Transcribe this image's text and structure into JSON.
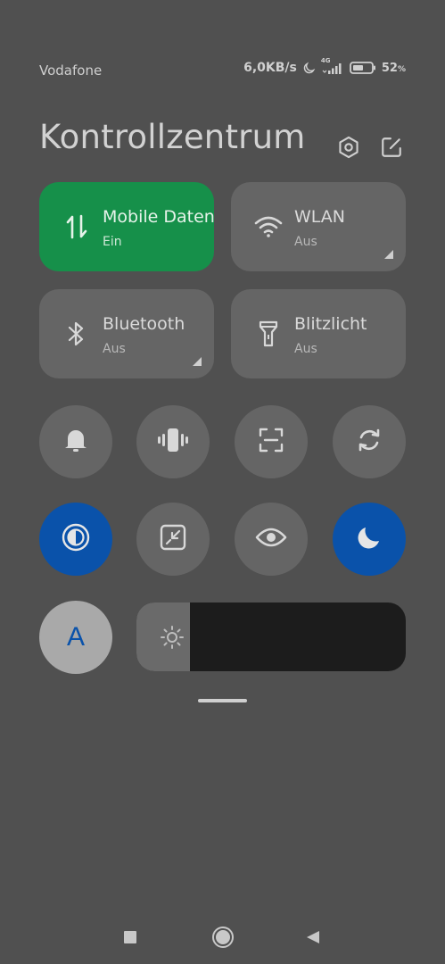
{
  "status_bar": {
    "carrier": "Vodafone",
    "net_speed": "6,0KB/s",
    "network_type": "4G",
    "battery_percent": "52",
    "battery_unit": "%",
    "icons": [
      "moon-icon",
      "signal-icon",
      "battery-icon"
    ]
  },
  "header": {
    "title": "Kontrollzentrum",
    "icons": [
      "settings-hexagon-icon",
      "edit-icon"
    ]
  },
  "tiles": [
    {
      "label": "Mobile Daten",
      "state": "Ein",
      "icon": "mobile-data-icon",
      "active": true
    },
    {
      "label": "WLAN",
      "state": "Aus",
      "icon": "wifi-icon",
      "active": false
    },
    {
      "label": "Bluetooth",
      "state": "Aus",
      "icon": "bluetooth-icon",
      "active": false
    },
    {
      "label": "Blitzlicht",
      "state": "Aus",
      "icon": "flashlight-icon",
      "active": false
    }
  ],
  "toggles_row1": [
    {
      "icon": "bell-icon",
      "active": false
    },
    {
      "icon": "vibrate-icon",
      "active": false
    },
    {
      "icon": "screenshot-icon",
      "active": false
    },
    {
      "icon": "auto-rotate-icon",
      "active": false
    }
  ],
  "toggles_row2": [
    {
      "icon": "invert-colors-icon",
      "active": true
    },
    {
      "icon": "floating-window-icon",
      "active": false
    },
    {
      "icon": "eye-icon",
      "active": false
    },
    {
      "icon": "moon-icon",
      "active": true
    }
  ],
  "auto_brightness": {
    "label": "A",
    "icon": "auto-brightness-icon"
  },
  "brightness": {
    "level": 0.2,
    "icon": "sun-icon"
  },
  "colors": {
    "active_green": "#16904a",
    "active_blue": "#0a52aa",
    "tile_bg": "#656565",
    "background": "#505050"
  },
  "nav_bar": [
    "recents-square-icon",
    "home-circle-icon",
    "back-triangle-icon"
  ]
}
